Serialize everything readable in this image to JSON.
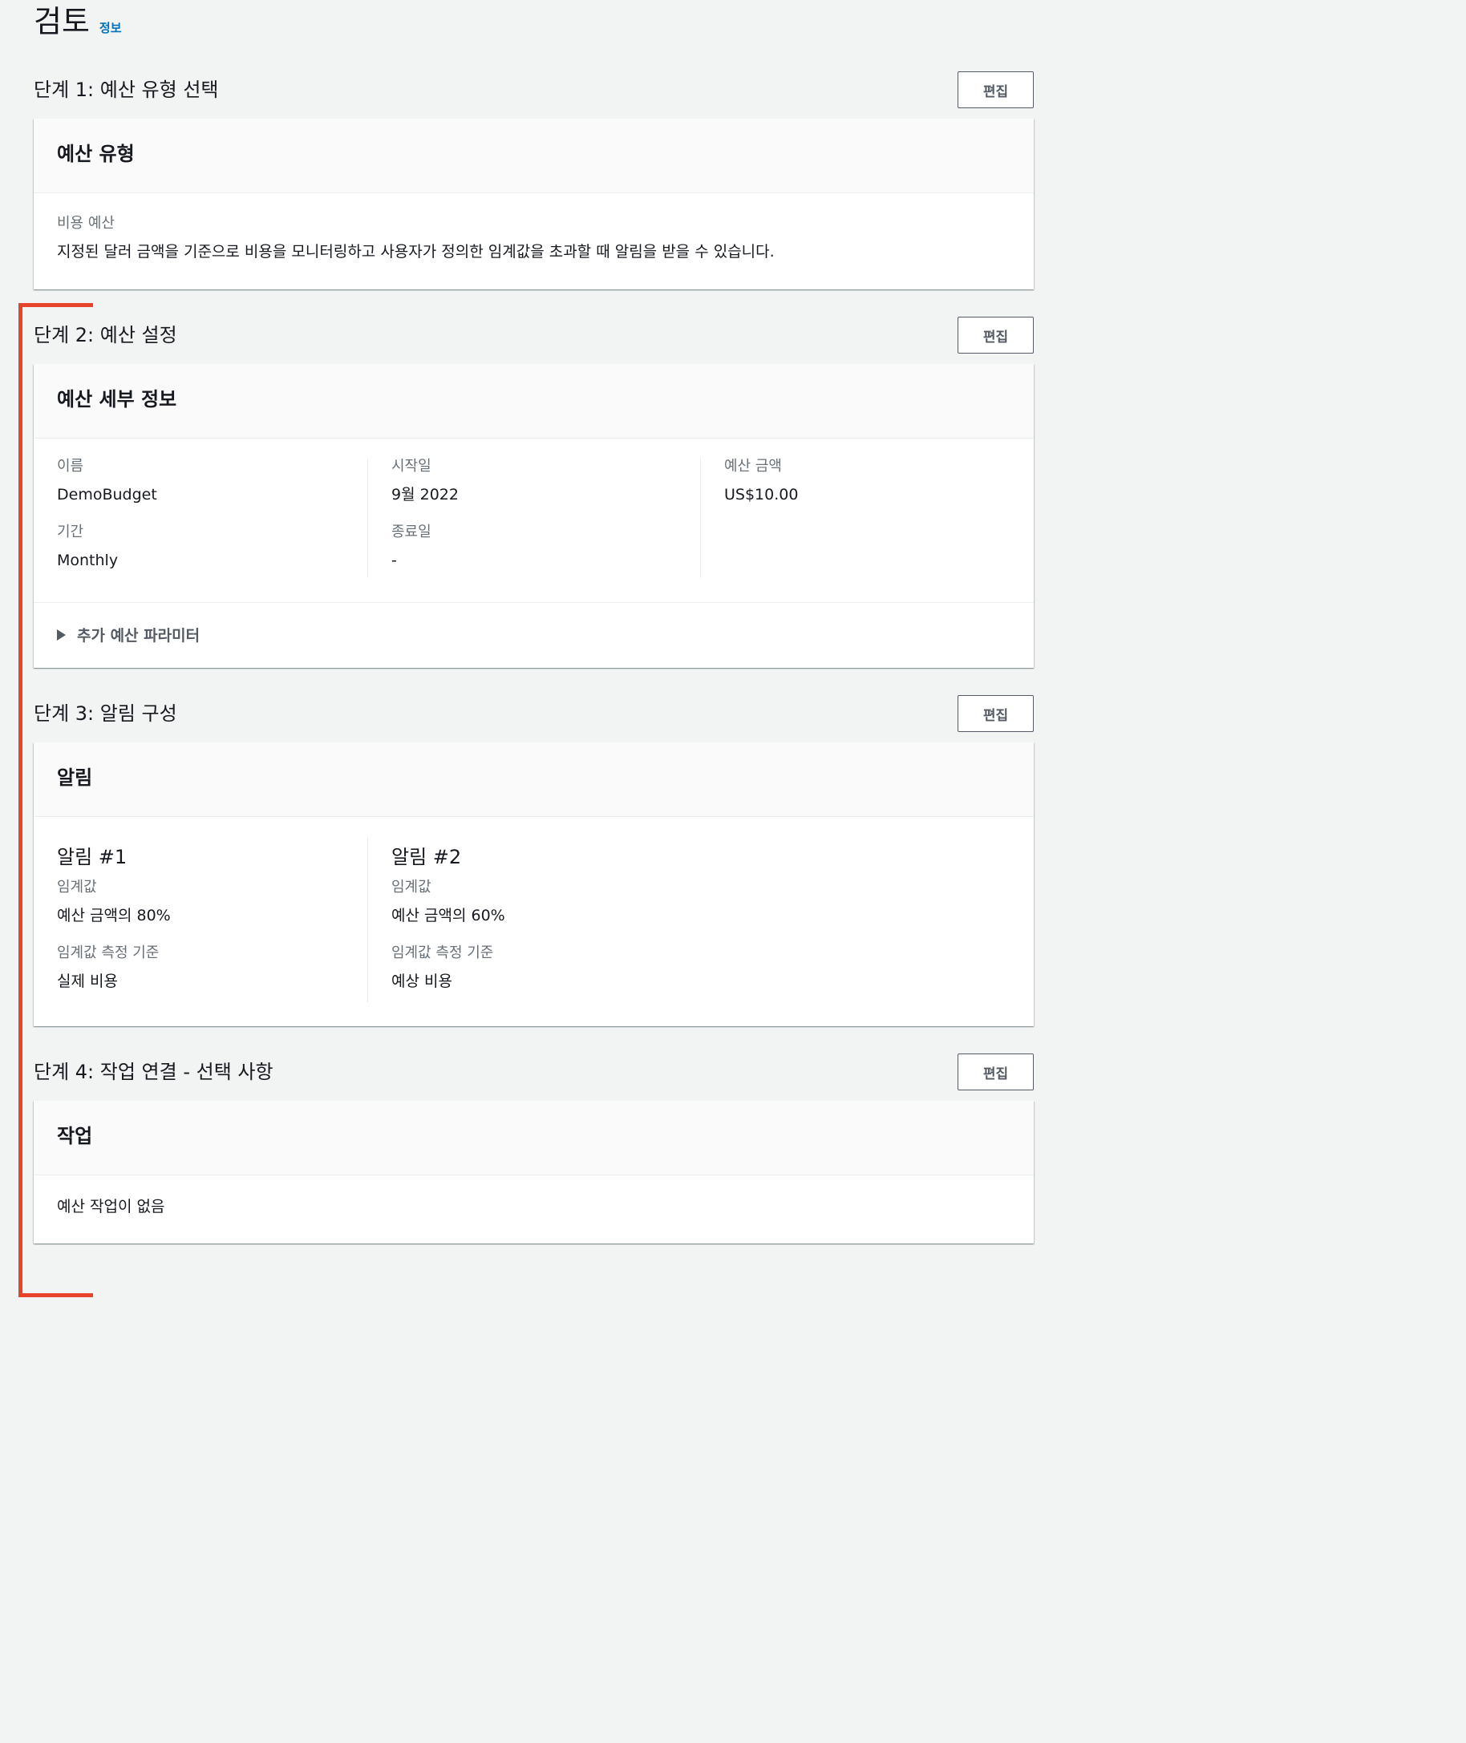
{
  "page": {
    "title": "검토",
    "info_link": "정보"
  },
  "edit_label": "편집",
  "step1": {
    "title": "단계 1: 예산 유형 선택",
    "card_title": "예산 유형",
    "type_label": "비용 예산",
    "type_description": "지정된 달러 금액을 기준으로 비용을 모니터링하고 사용자가 정의한 임계값을 초과할 때 알림을 받을 수 있습니다."
  },
  "step2": {
    "title": "단계 2: 예산 설정",
    "card_title": "예산 세부 정보",
    "fields": {
      "name_label": "이름",
      "name_value": "DemoBudget",
      "period_label": "기간",
      "period_value": "Monthly",
      "start_label": "시작일",
      "start_value": "9월 2022",
      "end_label": "종료일",
      "end_value": "-",
      "amount_label": "예산 금액",
      "amount_value": "US$10.00"
    },
    "expander_label": "추가 예산 파라미터"
  },
  "step3": {
    "title": "단계 3: 알림 구성",
    "card_title": "알림",
    "alerts": [
      {
        "title": "알림 #1",
        "threshold_label": "임계값",
        "threshold_value": "예산 금액의 80%",
        "basis_label": "임계값 측정 기준",
        "basis_value": "실제 비용"
      },
      {
        "title": "알림 #2",
        "threshold_label": "임계값",
        "threshold_value": "예산 금액의 60%",
        "basis_label": "임계값 측정 기준",
        "basis_value": "예상 비용"
      }
    ]
  },
  "step4": {
    "title": "단계 4: 작업 연결 - 선택 사항",
    "card_title": "작업",
    "empty_text": "예산 작업이 없음"
  },
  "colors": {
    "accent_link": "#0073bb",
    "highlight_bracket": "#e8442c",
    "background": "#f2f3f3"
  }
}
